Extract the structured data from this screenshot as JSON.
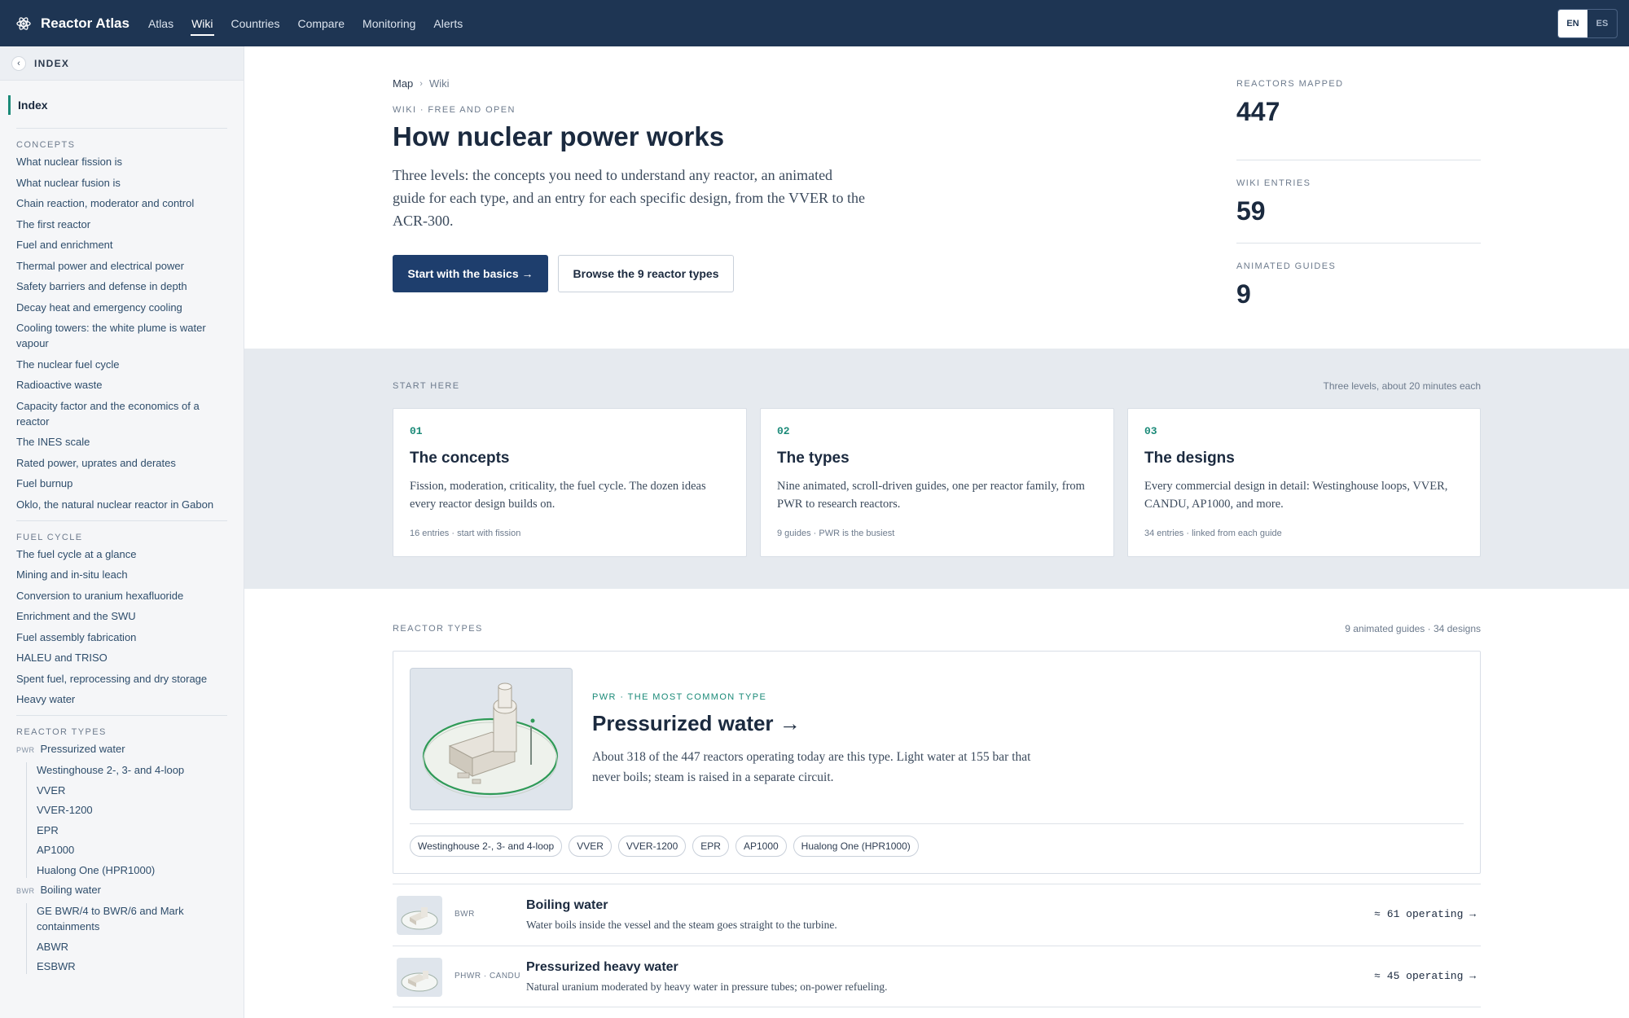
{
  "app": {
    "name": "Reactor Atlas",
    "icon": "atom-icon",
    "nav": [
      "Atlas",
      "Wiki",
      "Countries",
      "Compare",
      "Monitoring",
      "Alerts"
    ],
    "active_nav": "Wiki",
    "languages": [
      "EN",
      "ES"
    ],
    "active_language": "EN"
  },
  "sidebar": {
    "header": "INDEX",
    "index_label": "Index",
    "concepts": {
      "title": "CONCEPTS",
      "items": [
        "What nuclear fission is",
        "What nuclear fusion is",
        "Chain reaction, moderator and control",
        "The first reactor",
        "Fuel and enrichment",
        "Thermal power and electrical power",
        "Safety barriers and defense in depth",
        "Decay heat and emergency cooling",
        "Cooling towers: the white plume is water vapour",
        "The nuclear fuel cycle",
        "Radioactive waste",
        "Capacity factor and the economics of a reactor",
        "The INES scale",
        "Rated power, uprates and derates",
        "Fuel burnup",
        "Oklo, the natural nuclear reactor in Gabon"
      ]
    },
    "fuel_cycle": {
      "title": "FUEL CYCLE",
      "items": [
        "The fuel cycle at a glance",
        "Mining and in-situ leach",
        "Conversion to uranium hexafluoride",
        "Enrichment and the SWU",
        "Fuel assembly fabrication",
        "HALEU and TRISO",
        "Spent fuel, reprocessing and dry storage",
        "Heavy water"
      ]
    },
    "reactor_types": {
      "title": "REACTOR TYPES",
      "pwr": {
        "abbr": "PWR",
        "name": "Pressurized water",
        "designs": [
          "Westinghouse 2-, 3- and 4-loop",
          "VVER",
          "VVER-1200",
          "EPR",
          "AP1000",
          "Hualong One (HPR1000)"
        ]
      },
      "bwr": {
        "abbr": "BWR",
        "name": "Boiling water",
        "designs": [
          "GE BWR/4 to BWR/6 and Mark containments",
          "ABWR",
          "ESBWR"
        ]
      }
    }
  },
  "hero": {
    "breadcrumb": [
      "Map",
      "Wiki"
    ],
    "eyebrow": "WIKI · FREE AND OPEN",
    "title": "How nuclear power works",
    "lede": "Three levels: the concepts you need to understand any reactor, an animated guide for each type, and an entry for each specific design, from the VVER to the ACR-300.",
    "primary_button": "Start with the basics →",
    "secondary_button": "Browse the 9 reactor types"
  },
  "stats": [
    {
      "label": "REACTORS MAPPED",
      "value": "447"
    },
    {
      "label": "WIKI ENTRIES",
      "value": "59"
    },
    {
      "label": "ANIMATED GUIDES",
      "value": "9"
    }
  ],
  "start_here": {
    "label": "START HERE",
    "right": "Three levels, about 20 minutes each",
    "cards": [
      {
        "num": "01",
        "title": "The concepts",
        "desc": "Fission, moderation, criticality, the fuel cycle. The dozen ideas every reactor design builds on.",
        "meta": "16 entries · start with fission"
      },
      {
        "num": "02",
        "title": "The types",
        "desc": "Nine animated, scroll-driven guides, one per reactor family, from PWR to research reactors.",
        "meta": "9 guides · PWR is the busiest"
      },
      {
        "num": "03",
        "title": "The designs",
        "desc": "Every commercial design in detail: Westinghouse loops, VVER, CANDU, AP1000, and more.",
        "meta": "34 entries · linked from each guide"
      }
    ]
  },
  "reactor_types": {
    "label": "REACTOR TYPES",
    "right": "9 animated guides · 34 designs",
    "featured": {
      "eyebrow": "PWR · THE MOST COMMON TYPE",
      "title": "Pressurized water →",
      "desc": "About 318 of the 447 reactors operating today are this type. Light water at 155 bar that never boils; steam is raised in a separate circuit.",
      "chips": [
        "Westinghouse 2-, 3- and 4-loop",
        "VVER",
        "VVER-1200",
        "EPR",
        "AP1000",
        "Hualong One (HPR1000)"
      ]
    },
    "list": [
      {
        "abbr": "BWR",
        "name": "Boiling water",
        "desc": "Water boils inside the vessel and the steam goes straight to the turbine.",
        "count": "≈ 61 operating →"
      },
      {
        "abbr": "PHWR · CANDU",
        "name": "Pressurized heavy water",
        "desc": "Natural uranium moderated by heavy water in pressure tubes; on-power refueling.",
        "count": "≈ 45 operating →"
      }
    ]
  }
}
